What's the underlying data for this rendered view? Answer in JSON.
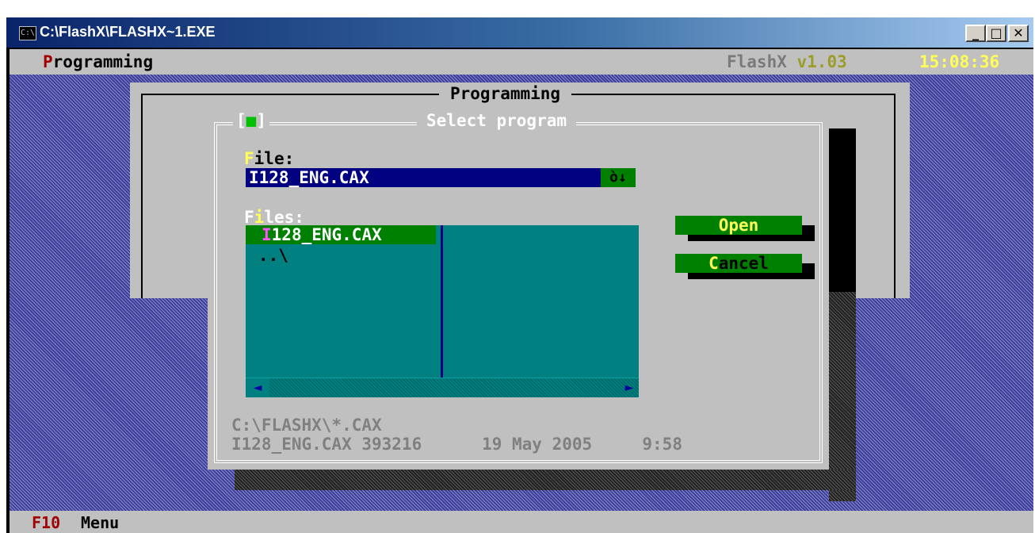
{
  "window": {
    "title": "C:\\FlashX\\FLASHX~1.EXE",
    "app_icon": "C:\\",
    "minimize_glyph": "_",
    "maximize_glyph": "□",
    "close_glyph": "✕"
  },
  "menubar": {
    "menu_hotkey": "P",
    "menu_rest": "rogramming",
    "app_name": "FlashX ",
    "version": "v1.03",
    "clock": "15:08:36"
  },
  "panel": {
    "title": "Programming"
  },
  "dialog": {
    "title": "Select program",
    "close_box_left": "[",
    "close_box_mark": "■",
    "close_box_right": "]",
    "file_label_hotkey": "F",
    "file_label_rest": "ile:",
    "file_value": "I128_ENG.CAX",
    "history_glyph": "ò↓",
    "files_label_first": "F",
    "files_label_hotkey": "i",
    "files_label_rest": "les:",
    "files": [
      {
        "hotkey": "I",
        "rest": "128_ENG.CAX"
      },
      {
        "name": "..\\"
      }
    ],
    "scroll_left": "◄",
    "scroll_right": "►",
    "open_label": "Open",
    "cancel_hotkey": "C",
    "cancel_rest": "ancel",
    "path": "C:\\FLASHX\\*.CAX",
    "info": {
      "file": "I128_ENG.CAX",
      "size": "393216",
      "date": "19 May 2005",
      "time": "9:58"
    }
  },
  "statusbar": {
    "key": "F10",
    "label": "Menu"
  }
}
